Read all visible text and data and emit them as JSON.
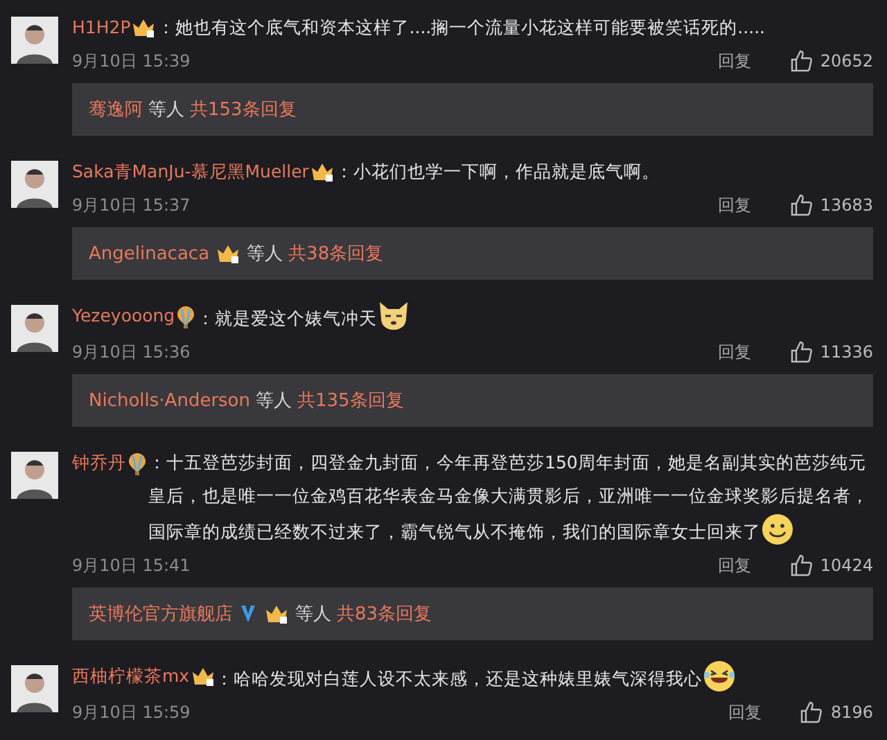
{
  "comments": [
    {
      "name": "H1H2P",
      "badges": [
        {
          "kind": "crown"
        }
      ],
      "text": "：她也有这个底气和资本这样了....搁一个流量小花这样可能要被笑话死的.....",
      "date": "9月10日 15:39",
      "reply_label": "回复",
      "likes": "20652",
      "replies": {
        "names": [
          {
            "name": "骞逸阿"
          }
        ],
        "others": "等人",
        "count": "共153条回复"
      }
    },
    {
      "name": "Saka青ManJu-慕尼黑Mueller",
      "badges": [
        {
          "kind": "crown"
        }
      ],
      "text": "：小花们也学一下啊，作品就是底气啊。",
      "date": "9月10日 15:37",
      "reply_label": "回复",
      "likes": "13683",
      "replies": {
        "names": [
          {
            "name": "Angelinacaca",
            "badges": [
              {
                "kind": "crown"
              }
            ]
          }
        ],
        "others": "等人",
        "count": "共38条回复"
      }
    },
    {
      "name": "Yezeyooong",
      "badges": [
        {
          "kind": "balloon"
        }
      ],
      "text": "：就是爱这个婊气冲天",
      "emoji": {
        "kind": "dog"
      },
      "date": "9月10日 15:36",
      "reply_label": "回复",
      "likes": "11336",
      "replies": {
        "names": [
          {
            "name": "Nicholls·Anderson"
          }
        ],
        "others": "等人",
        "count": "共135条回复"
      }
    },
    {
      "name": "钟乔丹",
      "badges": [
        {
          "kind": "balloon"
        }
      ],
      "text": "：十五登芭莎封面，四登金九封面，今年再登芭莎150周年封面，她是名副其实的芭莎纯元皇后，也是唯一一位金鸡百花华表金马金像大满贯影后，亚洲唯一一位金球奖影后提名者，国际章的成绩已经数不过来了，霸气锐气从不掩饰，我们的国际章女士回来了",
      "emoji": {
        "kind": "smile"
      },
      "date": "9月10日 15:41",
      "reply_label": "回复",
      "likes": "10424",
      "replies": {
        "names": [
          {
            "name": "英博伦官方旗舰店",
            "badges": [
              {
                "kind": "verified"
              },
              {
                "kind": "crown"
              }
            ]
          }
        ],
        "others": "等人",
        "count": "共83条回复"
      }
    },
    {
      "name": "西柚柠檬茶mx",
      "badges": [
        {
          "kind": "crown"
        }
      ],
      "text": "：哈哈发现对白莲人设不太来感，还是这种婊里婊气深得我心",
      "emoji": {
        "kind": "laugh"
      },
      "date": "9月10日 15:59",
      "reply_label": "回复",
      "likes": "8196"
    }
  ]
}
